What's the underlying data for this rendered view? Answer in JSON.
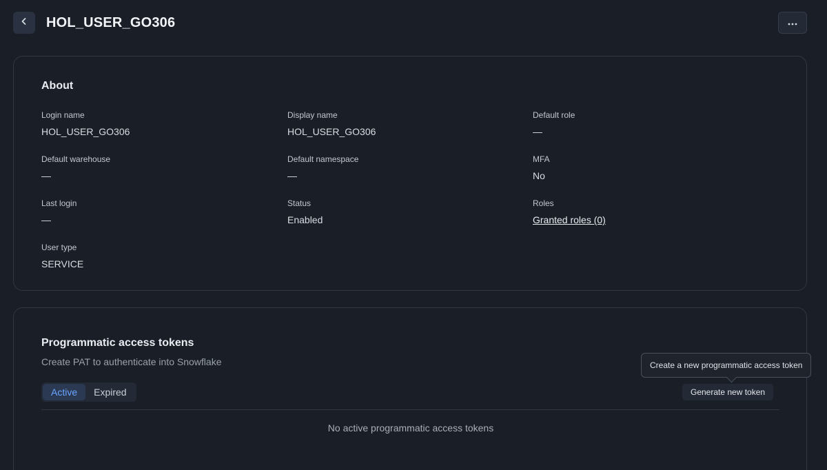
{
  "header": {
    "title": "HOL_USER_GO306",
    "back_icon": "chevron-left-icon",
    "more_icon": "more-horizontal-icon"
  },
  "about": {
    "title": "About",
    "fields": {
      "login_name": {
        "label": "Login name",
        "value": "HOL_USER_GO306"
      },
      "display_name": {
        "label": "Display name",
        "value": "HOL_USER_GO306"
      },
      "default_role": {
        "label": "Default role",
        "value": "—"
      },
      "default_warehouse": {
        "label": "Default warehouse",
        "value": "—"
      },
      "default_namespace": {
        "label": "Default namespace",
        "value": "—"
      },
      "mfa": {
        "label": "MFA",
        "value": "No"
      },
      "last_login": {
        "label": "Last login",
        "value": "—"
      },
      "status": {
        "label": "Status",
        "value": "Enabled"
      },
      "roles": {
        "label": "Roles",
        "value": "Granted roles (0)"
      },
      "user_type": {
        "label": "User type",
        "value": "SERVICE"
      }
    }
  },
  "pat": {
    "title": "Programmatic access tokens",
    "subtitle": "Create PAT to authenticate into Snowflake",
    "tabs": [
      {
        "label": "Active",
        "active": true
      },
      {
        "label": "Expired",
        "active": false
      }
    ],
    "generate_label": "Generate new token",
    "tooltip": "Create a new programmatic access token",
    "empty_message": "No active programmatic access tokens"
  },
  "colors": {
    "background": "#1a1e26",
    "accent": "#6aa5ff",
    "card_border": "#303745"
  }
}
